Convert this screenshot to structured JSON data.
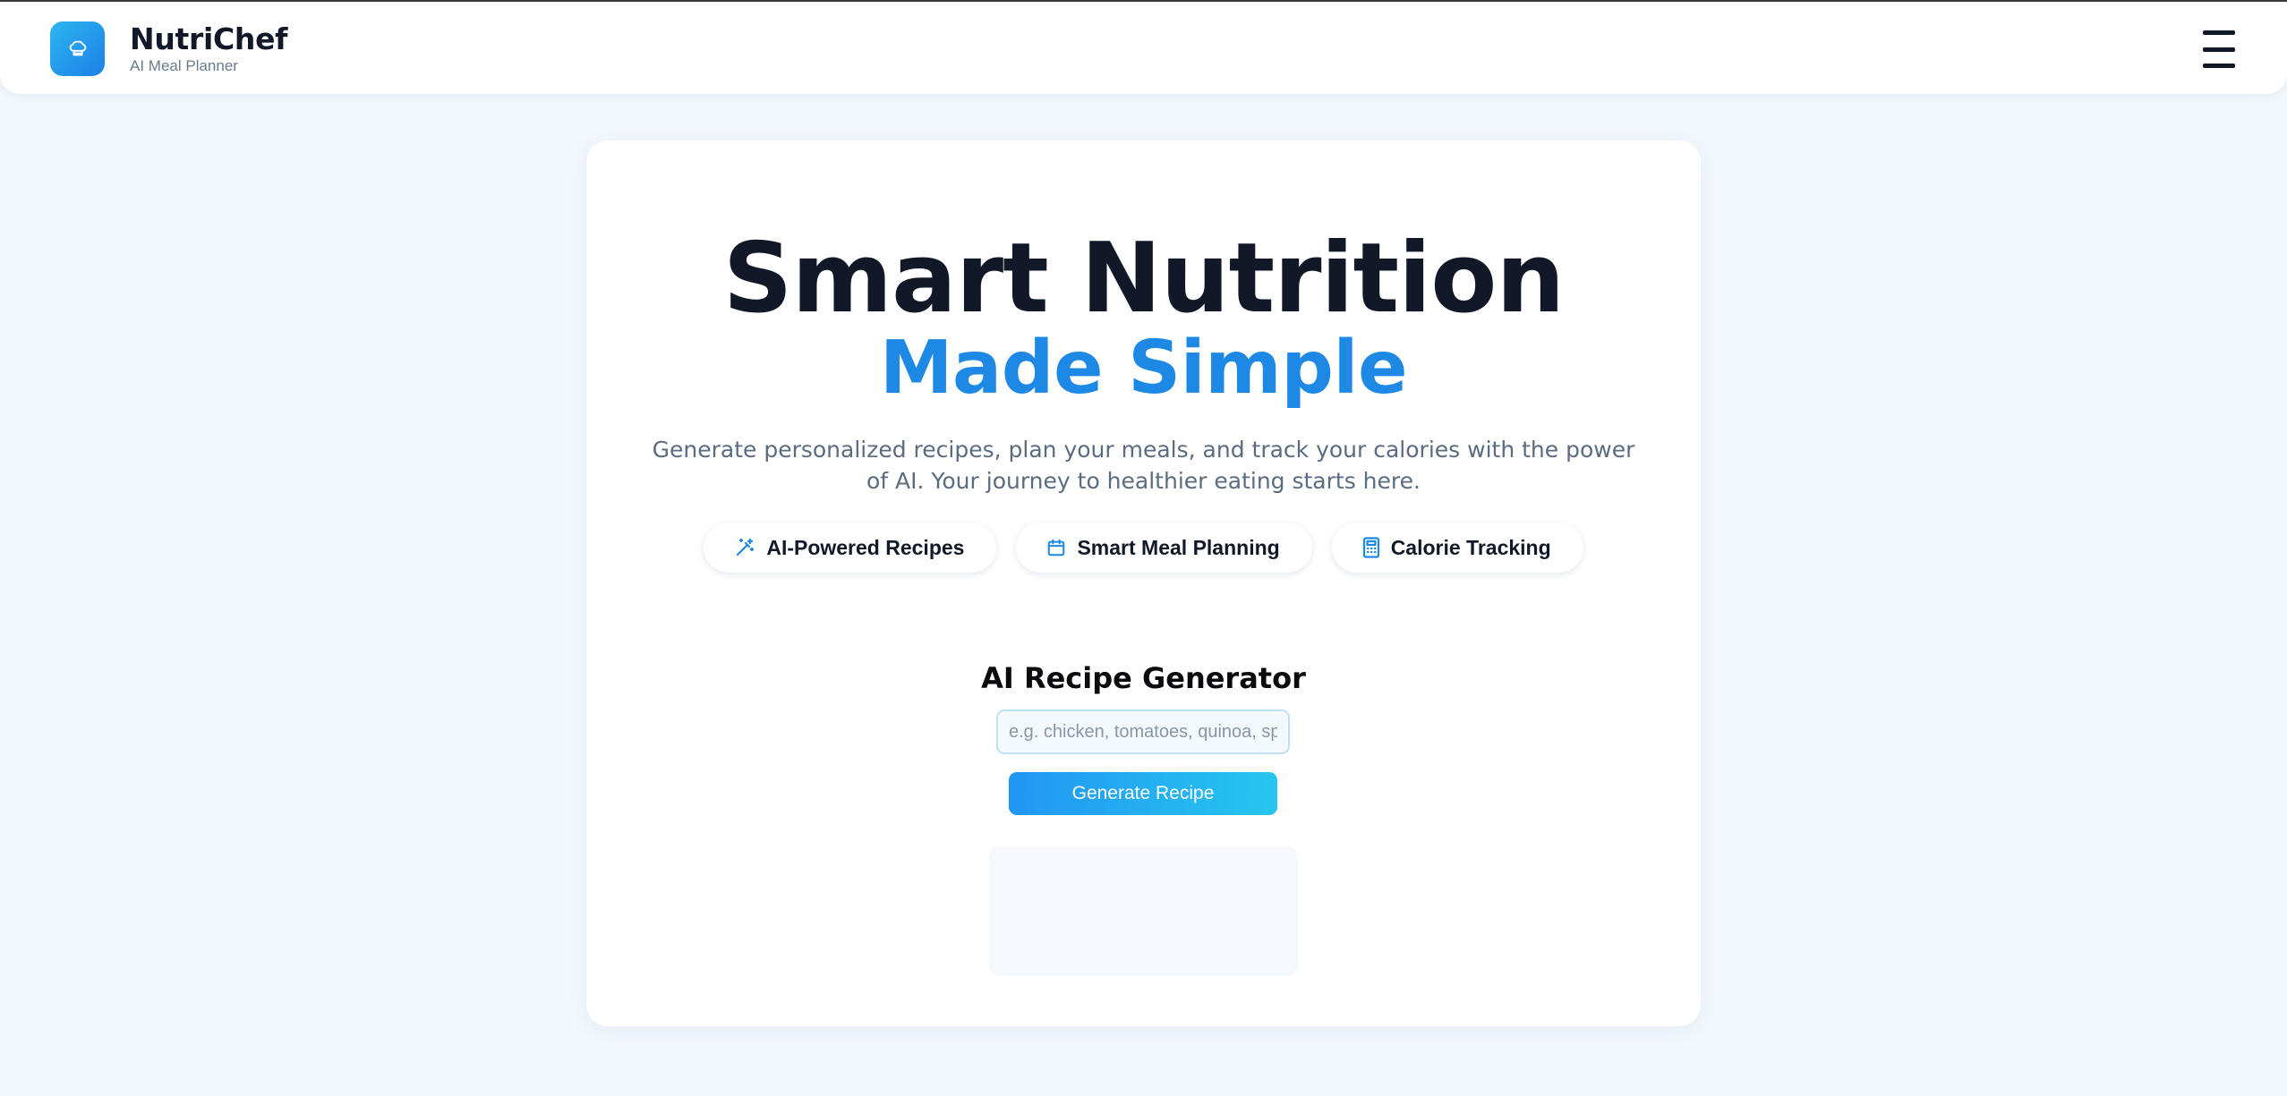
{
  "header": {
    "brand_name": "NutriChef",
    "brand_subtitle": "AI Meal Planner",
    "logo_icon": "chef-hat-icon",
    "menu_icon": "hamburger-menu-icon"
  },
  "hero": {
    "title": "Smart Nutrition",
    "subtitle": "Made Simple",
    "description": "Generate personalized recipes, plan your meals, and track your calories with the power of AI. Your journey to healthier eating starts here."
  },
  "features": [
    {
      "label": "AI-Powered Recipes",
      "icon": "magic-wand-icon"
    },
    {
      "label": "Smart Meal Planning",
      "icon": "calendar-icon"
    },
    {
      "label": "Calorie Tracking",
      "icon": "calculator-icon"
    }
  ],
  "generator": {
    "title": "AI Recipe Generator",
    "input_placeholder": "e.g. chicken, tomatoes, quinoa, spinach",
    "input_value": "",
    "button_label": "Generate Recipe"
  },
  "colors": {
    "accent": "#1e88e5",
    "page_background": "#f3f8fc",
    "button_gradient_start": "#2196f3",
    "button_gradient_end": "#26c6ef"
  }
}
